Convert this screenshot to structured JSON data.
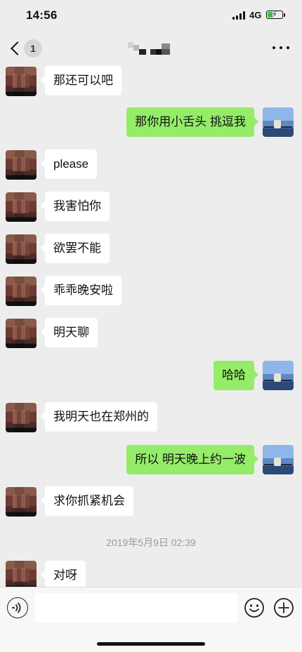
{
  "status_bar": {
    "time": "14:56",
    "network": "4G",
    "battery_level": 0.3,
    "battery_color": "#38c448"
  },
  "nav": {
    "back_icon": "chevron-left-icon",
    "unread_count": "1",
    "more_icon": "more-dots-icon"
  },
  "messages": [
    {
      "side": "left",
      "text": "那还可以吧"
    },
    {
      "side": "right",
      "text": "那你用小舌头 挑逗我"
    },
    {
      "side": "left",
      "text": "please"
    },
    {
      "side": "left",
      "text": "我害怕你"
    },
    {
      "side": "left",
      "text": "欲罢不能"
    },
    {
      "side": "left",
      "text": "乖乖晚安啦"
    },
    {
      "side": "left",
      "text": "明天聊"
    },
    {
      "side": "right",
      "text": "哈哈"
    },
    {
      "side": "left",
      "text": "我明天也在郑州的"
    },
    {
      "side": "right",
      "text": "所以 明天晚上约一波"
    },
    {
      "side": "left",
      "text": "求你抓紧机会"
    },
    {
      "side": "left",
      "text": "对呀"
    }
  ],
  "timestamp": "2019年5月9日 02:39",
  "input_bar": {
    "voice_icon": "voice-icon",
    "input_value": "",
    "emoji_icon": "emoji-icon",
    "plus_icon": "plus-icon"
  },
  "colors": {
    "background": "#ededed",
    "bubble_self": "#95ec69",
    "bubble_other": "#ffffff",
    "timestamp_text": "#9a9a9a"
  }
}
